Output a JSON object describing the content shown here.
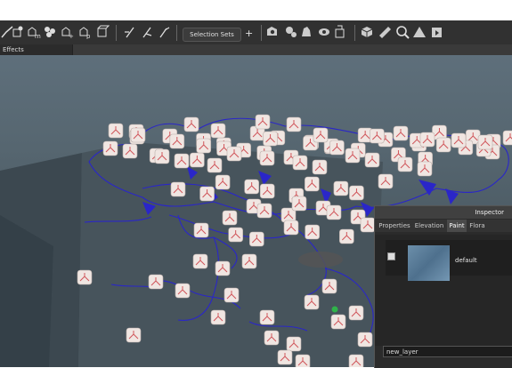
{
  "toolbar": {
    "selection_sets_label": "Selection Sets",
    "plus_label": "+",
    "icons": [
      "terrain-brush-icon",
      "object-tool-icon",
      "multi-place-icon",
      "scatter-icon",
      "paint-place-icon",
      "path-place-icon",
      "box-place-icon",
      "align-tool-icon",
      "normal-tool-icon",
      "pick-tool-icon",
      "selection-sets-button",
      "add-selection-set-icon",
      "camera-tool-icon",
      "sphere-tool-icon",
      "sculpt-tool-icon",
      "eye-tool-icon",
      "lightbox-tool-icon",
      "cube-tool-icon",
      "measure-tool-icon",
      "search-tool-icon",
      "triangle-tool-icon",
      "export-tool-icon"
    ]
  },
  "effects_tab": {
    "label": "Effects"
  },
  "inspector": {
    "title": "Inspector",
    "tabs": [
      {
        "label": "Properties",
        "active": false
      },
      {
        "label": "Elevation",
        "active": false
      },
      {
        "label": "Paint",
        "active": true
      },
      {
        "label": "Flora",
        "active": false
      }
    ],
    "layer": {
      "name": "default",
      "checked": true
    },
    "new_layer_value": "new_layer"
  },
  "colors": {
    "toolbar_bg": "#313131",
    "viewport_top": "#5e6f7b",
    "outline_blue": "#2a26c8",
    "marker_face": "#f0e6e2",
    "marker_accent": "#d0555a"
  }
}
